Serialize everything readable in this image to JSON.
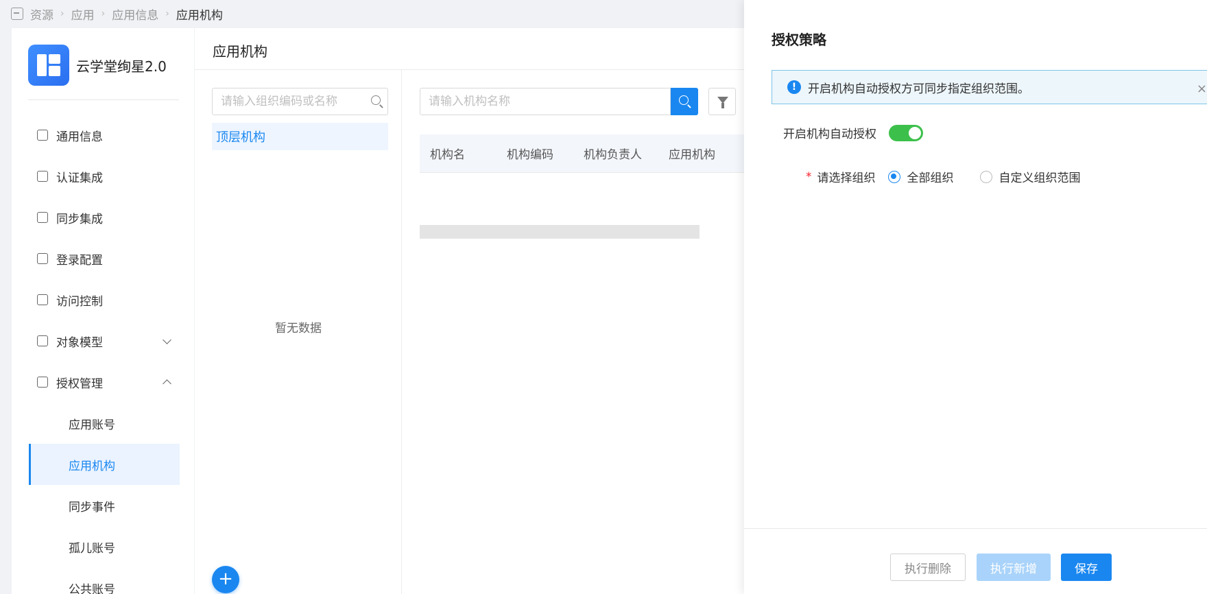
{
  "breadcrumb": {
    "items": [
      "资源",
      "应用",
      "应用信息",
      "应用机构"
    ]
  },
  "app": {
    "name": "云学堂绚星2.0"
  },
  "sidebar": {
    "items": [
      {
        "label": "通用信息"
      },
      {
        "label": "认证集成"
      },
      {
        "label": "同步集成"
      },
      {
        "label": "登录配置"
      },
      {
        "label": "访问控制"
      },
      {
        "label": "对象模型"
      },
      {
        "label": "授权管理"
      }
    ],
    "subitems": [
      {
        "label": "应用账号"
      },
      {
        "label": "应用机构"
      },
      {
        "label": "同步事件"
      },
      {
        "label": "孤儿账号"
      },
      {
        "label": "公共账号"
      }
    ]
  },
  "main": {
    "title": "应用机构",
    "tree_search_placeholder": "请输入组织编码或名称",
    "tree_node": "顶层机构",
    "empty_text": "暂无数据",
    "fab": "+",
    "org_search_placeholder": "请输入机构名称",
    "table_headers": [
      "机构名",
      "机构编码",
      "机构负责人",
      "应用机构"
    ]
  },
  "drawer": {
    "title": "授权策略",
    "alert_text": "开启机构自动授权方可同步指定组织范围。",
    "alert_close": "×",
    "auto_auth_label": "开启机构自动授权",
    "auto_auth_enabled": true,
    "select_org_label": "请选择组织",
    "required_mark": "*",
    "radio_all": "全部组织",
    "radio_custom": "自定义组织范围",
    "selected_option": "全部组织",
    "btn_delete": "执行删除",
    "btn_add": "执行新增",
    "btn_save": "保存"
  },
  "colors": {
    "primary": "#1a87f0",
    "toggle_on": "#3cc04b",
    "required": "#f5222d"
  }
}
